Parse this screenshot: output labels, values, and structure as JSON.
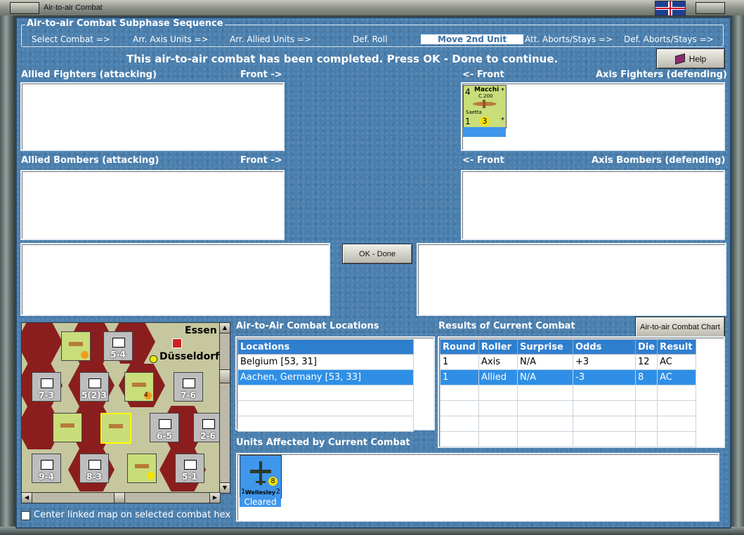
{
  "window": {
    "title": "Air-to-air Combat"
  },
  "sequence": {
    "title": "Air-to-air Combat Subphase Sequence",
    "steps": [
      "Select Combat =>",
      "Arr. Axis Units =>",
      "Arr. Allied Units =>",
      "Def. Roll",
      "Move 2nd Unit",
      "Att. Aborts/Stays =>",
      "Def. Aborts/Stays =>"
    ],
    "active_index": 4
  },
  "status": "This air-to-air combat has been completed.  Press OK - Done to continue.",
  "help_button": "Help",
  "allied_fighters": {
    "label": "Allied Fighters (attacking)",
    "front": "Front ->"
  },
  "axis_fighters": {
    "label": "Axis Fighters (defending)",
    "front": "<- Front"
  },
  "allied_bombers": {
    "label": "Allied Bombers (attacking)",
    "front": "Front ->"
  },
  "axis_bombers": {
    "label": "Axis Bombers (defending)",
    "front": "<- Front"
  },
  "axis_fighter_unit": {
    "top_left": "4",
    "name": "Macchi",
    "model": "C.200",
    "subname": "Saetta",
    "bottom_left": "1",
    "bottom_mid": "3",
    "star": "*"
  },
  "ok_button": "OK - Done",
  "locations": {
    "title": "Air-to-Air Combat Locations",
    "header": "Locations",
    "rows": [
      "Belgium [53, 31]",
      "Aachen, Germany [53, 33]"
    ],
    "selected": 1
  },
  "results": {
    "title": "Results of Current Combat",
    "chart_button": "Air-to-air Combat Chart",
    "columns": [
      "Round",
      "Roller",
      "Surprise",
      "Odds",
      "Die",
      "Result"
    ],
    "rows": [
      [
        "1",
        "Axis",
        "N/A",
        "+3",
        "12",
        "AC"
      ],
      [
        "1",
        "Allied",
        "N/A",
        "-3",
        "8",
        "AC"
      ]
    ],
    "selected": 1
  },
  "affected": {
    "title": "Units Affected by Current Combat",
    "unit": {
      "name": "Wellesley",
      "left": "1",
      "right": "2",
      "circle": "8",
      "status": "Cleared"
    }
  },
  "map": {
    "cities": [
      "Essen",
      "Düsseldorf"
    ],
    "units": [
      {
        "label": "7-3"
      },
      {
        "label": "5(2)3"
      },
      {
        "label": "7-6"
      },
      {
        "label": "5-4"
      },
      {
        "label": "6-5"
      },
      {
        "label": "2-6"
      },
      {
        "label": "9-4"
      },
      {
        "label": "8-3"
      },
      {
        "label": "5-1"
      },
      {
        "label": "4"
      }
    ],
    "center_checkbox": "Center linked map on selected combat hex"
  },
  "colors": {
    "panel_bg": "#4a7fae",
    "highlight": "#2f8fe6",
    "header": "#2f7fcf"
  }
}
